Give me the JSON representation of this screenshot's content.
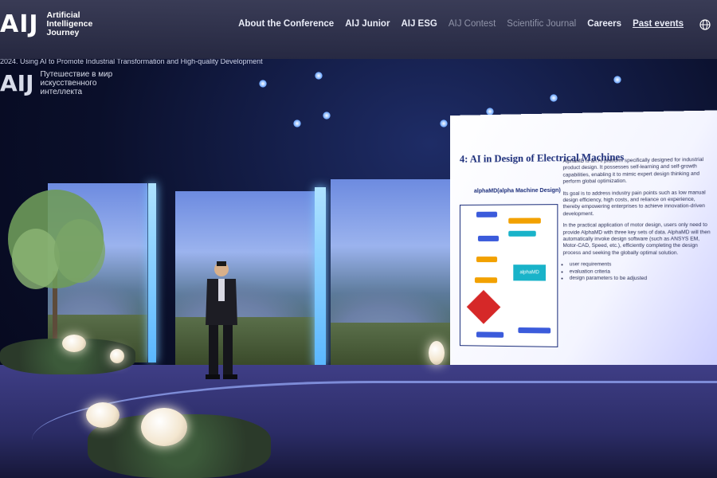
{
  "header": {
    "logo_mark": "AIJ",
    "logo_lines": [
      "Artificial",
      "Intelligence",
      "Journey"
    ],
    "nav": [
      {
        "label": "About the Conference",
        "state": "normal"
      },
      {
        "label": "AIJ Junior",
        "state": "normal"
      },
      {
        "label": "AIJ ESG",
        "state": "normal"
      },
      {
        "label": "AIJ Contest",
        "state": "muted"
      },
      {
        "label": "Scientific Journal",
        "state": "muted"
      },
      {
        "label": "Careers",
        "state": "normal"
      },
      {
        "label": "Past events",
        "state": "underline"
      }
    ],
    "language_icon": "globe-icon"
  },
  "video": {
    "ticker": "2024. Using AI to Promote Industrial Transformation and High-quality Development",
    "watermark_mark": "AIJ",
    "watermark_lines": [
      "Путешествие в мир",
      "искусственного",
      "интеллекта"
    ]
  },
  "slide": {
    "title": "4: AI in Design of Electrical Machines",
    "subtitle": "alphaMD(alpha Machine Design)",
    "paragraphs": [
      "AlphaMD is an AI platform specifically designed for industrial product design. It possesses self-learning and self-growth capabilities, enabling it to mimic expert design thinking and perform global optimization.",
      "Its goal is to address industry pain points such as low manual design efficiency, high costs, and reliance on experience, thereby empowering enterprises to achieve innovation-driven development.",
      "In the practical application of motor design, users only need to provide AlphaMD with three key sets of data. AlphaMD will then automatically invoke design software (such as ANSYS EM, Motor-CAD, Speed, etc.), efficiently completing the design process and seeking the globally optimal solution."
    ],
    "bullets": [
      "user requirements",
      "evaluation criteria",
      "design parameters to be adjusted"
    ],
    "diagram_label": "alphaMD"
  }
}
